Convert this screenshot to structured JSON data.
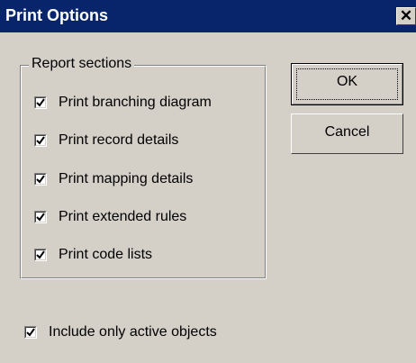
{
  "dialog": {
    "title": "Print Options",
    "close_glyph": "✕"
  },
  "report_sections": {
    "legend": "Report sections",
    "items": [
      {
        "label": "Print branching diagram",
        "checked": true
      },
      {
        "label": "Print record details",
        "checked": true
      },
      {
        "label": "Print mapping details",
        "checked": true
      },
      {
        "label": "Print extended rules",
        "checked": true
      },
      {
        "label": "Print code lists",
        "checked": true
      }
    ]
  },
  "active_only": {
    "label": "Include only active objects",
    "checked": true
  },
  "buttons": {
    "ok": "OK",
    "cancel": "Cancel"
  }
}
